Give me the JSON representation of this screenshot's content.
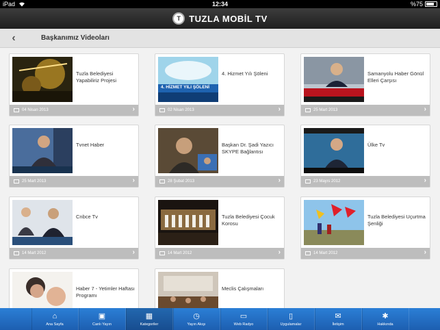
{
  "status": {
    "device": "iPad",
    "time": "12:34",
    "battery": "%75"
  },
  "app": {
    "title": "TUZLA MOBİL TV",
    "logo_text": "T"
  },
  "page": {
    "heading": "Başkanımız Videoları"
  },
  "videos": [
    {
      "title": "Tuzla Belediyesi Yapabiliriz Projesi",
      "date": "04 Nisan 2013"
    },
    {
      "title": "4. Hizmet Yılı Şöleni",
      "date": "02 Nisan 2013"
    },
    {
      "title": "Samanyolu Haber Gönül Elleri Çarşısı",
      "date": "25 Mart 2013"
    },
    {
      "title": "Tvnet Haber",
      "date": "25 Mart 2013"
    },
    {
      "title": "Başkan Dr. Şadi Yazıcı SKYPE Bağlantısı",
      "date": "28 Şubat 2013"
    },
    {
      "title": "Ülke Tv",
      "date": "23 Mayıs 2012"
    },
    {
      "title": "Cnbce Tv",
      "date": "14 Mart 2012"
    },
    {
      "title": "Tuzla Belediyesi Çocuk Korosu",
      "date": "14 Mart 2012"
    },
    {
      "title": "Tuzla Belediyesi Uçurtma Şenliği",
      "date": "14 Mart 2012"
    },
    {
      "title": "Haber 7 - Yetimler Haftası Programı",
      "date": ""
    },
    {
      "title": "Meclis Çalışmaları",
      "date": ""
    }
  ],
  "thumb_overlays": {
    "hizmet": "4. HİZMET YILI ŞÖLENİ"
  },
  "tabs": [
    {
      "label": "Ana Sayfa",
      "icon": "⌂",
      "icon_name": "home-icon"
    },
    {
      "label": "Canlı Yayın",
      "icon": "▣",
      "icon_name": "tv-icon"
    },
    {
      "label": "Kategoriler",
      "icon": "▦",
      "icon_name": "grid-icon"
    },
    {
      "label": "Yayın Akışı",
      "icon": "◷",
      "icon_name": "clock-icon"
    },
    {
      "label": "Web Radyo",
      "icon": "▭",
      "icon_name": "radio-icon"
    },
    {
      "label": "Uygulamalar",
      "icon": "▯",
      "icon_name": "phone-icon"
    },
    {
      "label": "İletişim",
      "icon": "✉",
      "icon_name": "chat-icon"
    },
    {
      "label": "Hakkında",
      "icon": "✱",
      "icon_name": "gear-icon"
    }
  ]
}
